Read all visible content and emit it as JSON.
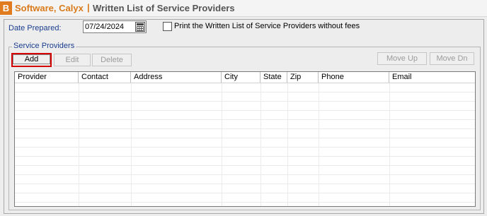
{
  "window": {
    "badge": "B",
    "title_name": "Software, Calyx",
    "separator": "|",
    "title_sub": "Written List of Service Providers"
  },
  "form": {
    "date_label": "Date Prepared:",
    "date_value": "07/24/2024",
    "print_checkbox_label": "Print the Written List of Service Providers without fees",
    "print_checkbox_checked": false
  },
  "service_providers": {
    "group_title": "Service Providers",
    "buttons": {
      "add": "Add",
      "edit": "Edit",
      "delete": "Delete",
      "move_up": "Move Up",
      "move_dn": "Move Dn"
    },
    "columns": [
      "Provider",
      "Contact",
      "Address",
      "City",
      "State",
      "Zip",
      "Phone",
      "Email"
    ],
    "rows": []
  },
  "colors": {
    "title_accent": "#d97a1a",
    "label_blue": "#1a3d8f",
    "highlight_red": "#d40000"
  }
}
